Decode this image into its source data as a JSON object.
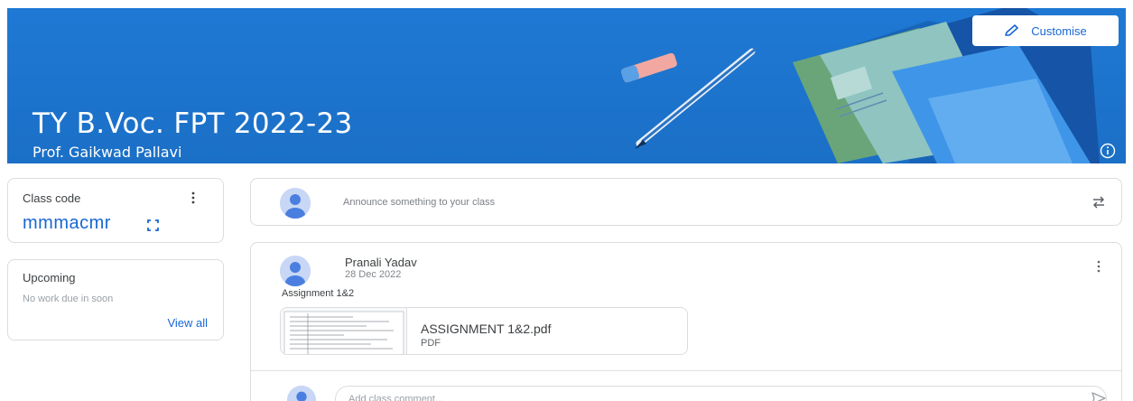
{
  "banner": {
    "title": "TY B.Voc. FPT 2022-23",
    "subtitle": "Prof. Gaikwad Pallavi",
    "customise_label": "Customise",
    "accent_color": "#1b6fc6"
  },
  "class_code": {
    "label": "Class code",
    "value": "mmmacmr"
  },
  "upcoming": {
    "title": "Upcoming",
    "empty_text": "No work due in soon",
    "view_all_label": "View all"
  },
  "announce": {
    "placeholder": "Announce something to your class"
  },
  "post": {
    "author": "Pranali Yadav",
    "date": "28 Dec 2022",
    "text": "Assignment 1&2",
    "attachment": {
      "name": "ASSIGNMENT 1&2.pdf",
      "type": "PDF"
    },
    "comment_placeholder": "Add class comment..."
  },
  "icons": {
    "customise": "pencil-icon",
    "info": "info-icon",
    "class_code_menu": "more-vert-icon",
    "class_code_display": "fullscreen-icon",
    "repost": "repost-icon",
    "post_menu": "more-vert-icon",
    "send": "send-icon"
  },
  "colors": {
    "link": "#1967d2",
    "border": "#dadce0"
  }
}
